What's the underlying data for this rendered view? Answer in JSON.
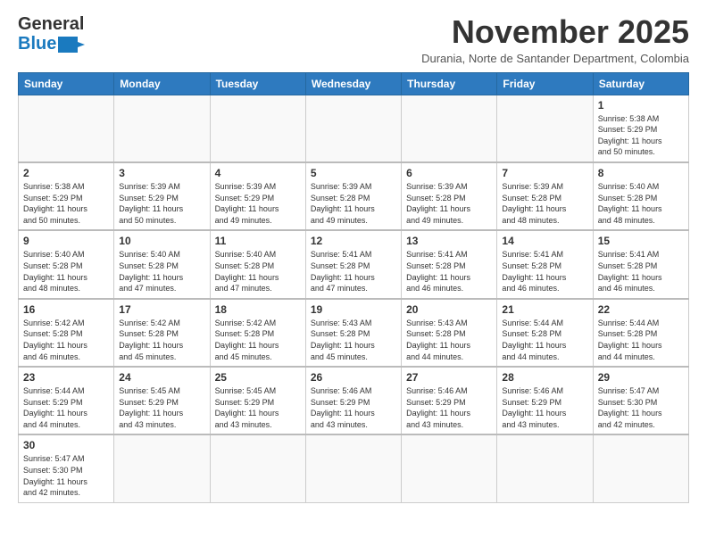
{
  "logo": {
    "general": "General",
    "blue": "Blue"
  },
  "header": {
    "month_year": "November 2025",
    "location": "Durania, Norte de Santander Department, Colombia"
  },
  "weekdays": [
    "Sunday",
    "Monday",
    "Tuesday",
    "Wednesday",
    "Thursday",
    "Friday",
    "Saturday"
  ],
  "weeks": [
    [
      {
        "day": "",
        "info": ""
      },
      {
        "day": "",
        "info": ""
      },
      {
        "day": "",
        "info": ""
      },
      {
        "day": "",
        "info": ""
      },
      {
        "day": "",
        "info": ""
      },
      {
        "day": "",
        "info": ""
      },
      {
        "day": "1",
        "info": "Sunrise: 5:38 AM\nSunset: 5:29 PM\nDaylight: 11 hours\nand 50 minutes."
      }
    ],
    [
      {
        "day": "2",
        "info": "Sunrise: 5:38 AM\nSunset: 5:29 PM\nDaylight: 11 hours\nand 50 minutes."
      },
      {
        "day": "3",
        "info": "Sunrise: 5:39 AM\nSunset: 5:29 PM\nDaylight: 11 hours\nand 50 minutes."
      },
      {
        "day": "4",
        "info": "Sunrise: 5:39 AM\nSunset: 5:29 PM\nDaylight: 11 hours\nand 49 minutes."
      },
      {
        "day": "5",
        "info": "Sunrise: 5:39 AM\nSunset: 5:28 PM\nDaylight: 11 hours\nand 49 minutes."
      },
      {
        "day": "6",
        "info": "Sunrise: 5:39 AM\nSunset: 5:28 PM\nDaylight: 11 hours\nand 49 minutes."
      },
      {
        "day": "7",
        "info": "Sunrise: 5:39 AM\nSunset: 5:28 PM\nDaylight: 11 hours\nand 48 minutes."
      },
      {
        "day": "8",
        "info": "Sunrise: 5:40 AM\nSunset: 5:28 PM\nDaylight: 11 hours\nand 48 minutes."
      }
    ],
    [
      {
        "day": "9",
        "info": "Sunrise: 5:40 AM\nSunset: 5:28 PM\nDaylight: 11 hours\nand 48 minutes."
      },
      {
        "day": "10",
        "info": "Sunrise: 5:40 AM\nSunset: 5:28 PM\nDaylight: 11 hours\nand 47 minutes."
      },
      {
        "day": "11",
        "info": "Sunrise: 5:40 AM\nSunset: 5:28 PM\nDaylight: 11 hours\nand 47 minutes."
      },
      {
        "day": "12",
        "info": "Sunrise: 5:41 AM\nSunset: 5:28 PM\nDaylight: 11 hours\nand 47 minutes."
      },
      {
        "day": "13",
        "info": "Sunrise: 5:41 AM\nSunset: 5:28 PM\nDaylight: 11 hours\nand 46 minutes."
      },
      {
        "day": "14",
        "info": "Sunrise: 5:41 AM\nSunset: 5:28 PM\nDaylight: 11 hours\nand 46 minutes."
      },
      {
        "day": "15",
        "info": "Sunrise: 5:41 AM\nSunset: 5:28 PM\nDaylight: 11 hours\nand 46 minutes."
      }
    ],
    [
      {
        "day": "16",
        "info": "Sunrise: 5:42 AM\nSunset: 5:28 PM\nDaylight: 11 hours\nand 46 minutes."
      },
      {
        "day": "17",
        "info": "Sunrise: 5:42 AM\nSunset: 5:28 PM\nDaylight: 11 hours\nand 45 minutes."
      },
      {
        "day": "18",
        "info": "Sunrise: 5:42 AM\nSunset: 5:28 PM\nDaylight: 11 hours\nand 45 minutes."
      },
      {
        "day": "19",
        "info": "Sunrise: 5:43 AM\nSunset: 5:28 PM\nDaylight: 11 hours\nand 45 minutes."
      },
      {
        "day": "20",
        "info": "Sunrise: 5:43 AM\nSunset: 5:28 PM\nDaylight: 11 hours\nand 44 minutes."
      },
      {
        "day": "21",
        "info": "Sunrise: 5:44 AM\nSunset: 5:28 PM\nDaylight: 11 hours\nand 44 minutes."
      },
      {
        "day": "22",
        "info": "Sunrise: 5:44 AM\nSunset: 5:28 PM\nDaylight: 11 hours\nand 44 minutes."
      }
    ],
    [
      {
        "day": "23",
        "info": "Sunrise: 5:44 AM\nSunset: 5:29 PM\nDaylight: 11 hours\nand 44 minutes."
      },
      {
        "day": "24",
        "info": "Sunrise: 5:45 AM\nSunset: 5:29 PM\nDaylight: 11 hours\nand 43 minutes."
      },
      {
        "day": "25",
        "info": "Sunrise: 5:45 AM\nSunset: 5:29 PM\nDaylight: 11 hours\nand 43 minutes."
      },
      {
        "day": "26",
        "info": "Sunrise: 5:46 AM\nSunset: 5:29 PM\nDaylight: 11 hours\nand 43 minutes."
      },
      {
        "day": "27",
        "info": "Sunrise: 5:46 AM\nSunset: 5:29 PM\nDaylight: 11 hours\nand 43 minutes."
      },
      {
        "day": "28",
        "info": "Sunrise: 5:46 AM\nSunset: 5:29 PM\nDaylight: 11 hours\nand 43 minutes."
      },
      {
        "day": "29",
        "info": "Sunrise: 5:47 AM\nSunset: 5:30 PM\nDaylight: 11 hours\nand 42 minutes."
      }
    ],
    [
      {
        "day": "30",
        "info": "Sunrise: 5:47 AM\nSunset: 5:30 PM\nDaylight: 11 hours\nand 42 minutes."
      },
      {
        "day": "",
        "info": ""
      },
      {
        "day": "",
        "info": ""
      },
      {
        "day": "",
        "info": ""
      },
      {
        "day": "",
        "info": ""
      },
      {
        "day": "",
        "info": ""
      },
      {
        "day": "",
        "info": ""
      }
    ]
  ]
}
